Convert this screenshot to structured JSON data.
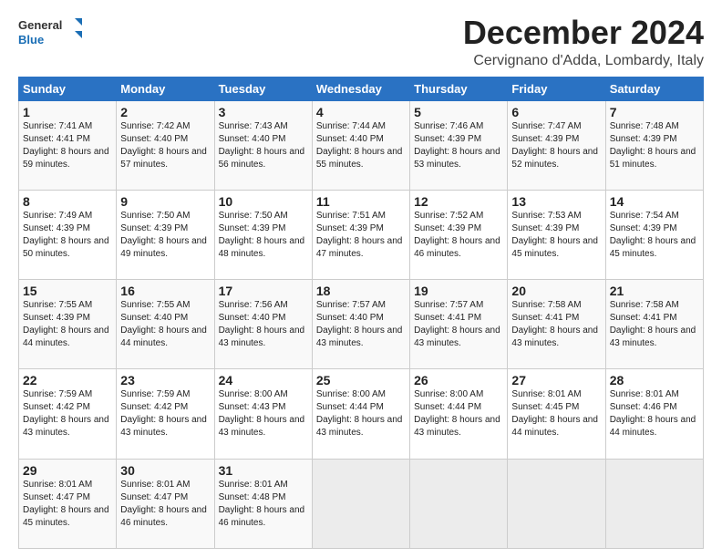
{
  "logo": {
    "line1": "General",
    "line2": "Blue"
  },
  "title": "December 2024",
  "location": "Cervignano d'Adda, Lombardy, Italy",
  "weekdays": [
    "Sunday",
    "Monday",
    "Tuesday",
    "Wednesday",
    "Thursday",
    "Friday",
    "Saturday"
  ],
  "weeks": [
    [
      {
        "day": 1,
        "sunrise": "7:41 AM",
        "sunset": "4:41 PM",
        "daylight": "8 hours and 59 minutes."
      },
      {
        "day": 2,
        "sunrise": "7:42 AM",
        "sunset": "4:40 PM",
        "daylight": "8 hours and 57 minutes."
      },
      {
        "day": 3,
        "sunrise": "7:43 AM",
        "sunset": "4:40 PM",
        "daylight": "8 hours and 56 minutes."
      },
      {
        "day": 4,
        "sunrise": "7:44 AM",
        "sunset": "4:40 PM",
        "daylight": "8 hours and 55 minutes."
      },
      {
        "day": 5,
        "sunrise": "7:46 AM",
        "sunset": "4:39 PM",
        "daylight": "8 hours and 53 minutes."
      },
      {
        "day": 6,
        "sunrise": "7:47 AM",
        "sunset": "4:39 PM",
        "daylight": "8 hours and 52 minutes."
      },
      {
        "day": 7,
        "sunrise": "7:48 AM",
        "sunset": "4:39 PM",
        "daylight": "8 hours and 51 minutes."
      }
    ],
    [
      {
        "day": 8,
        "sunrise": "7:49 AM",
        "sunset": "4:39 PM",
        "daylight": "8 hours and 50 minutes."
      },
      {
        "day": 9,
        "sunrise": "7:50 AM",
        "sunset": "4:39 PM",
        "daylight": "8 hours and 49 minutes."
      },
      {
        "day": 10,
        "sunrise": "7:50 AM",
        "sunset": "4:39 PM",
        "daylight": "8 hours and 48 minutes."
      },
      {
        "day": 11,
        "sunrise": "7:51 AM",
        "sunset": "4:39 PM",
        "daylight": "8 hours and 47 minutes."
      },
      {
        "day": 12,
        "sunrise": "7:52 AM",
        "sunset": "4:39 PM",
        "daylight": "8 hours and 46 minutes."
      },
      {
        "day": 13,
        "sunrise": "7:53 AM",
        "sunset": "4:39 PM",
        "daylight": "8 hours and 45 minutes."
      },
      {
        "day": 14,
        "sunrise": "7:54 AM",
        "sunset": "4:39 PM",
        "daylight": "8 hours and 45 minutes."
      }
    ],
    [
      {
        "day": 15,
        "sunrise": "7:55 AM",
        "sunset": "4:39 PM",
        "daylight": "8 hours and 44 minutes."
      },
      {
        "day": 16,
        "sunrise": "7:55 AM",
        "sunset": "4:40 PM",
        "daylight": "8 hours and 44 minutes."
      },
      {
        "day": 17,
        "sunrise": "7:56 AM",
        "sunset": "4:40 PM",
        "daylight": "8 hours and 43 minutes."
      },
      {
        "day": 18,
        "sunrise": "7:57 AM",
        "sunset": "4:40 PM",
        "daylight": "8 hours and 43 minutes."
      },
      {
        "day": 19,
        "sunrise": "7:57 AM",
        "sunset": "4:41 PM",
        "daylight": "8 hours and 43 minutes."
      },
      {
        "day": 20,
        "sunrise": "7:58 AM",
        "sunset": "4:41 PM",
        "daylight": "8 hours and 43 minutes."
      },
      {
        "day": 21,
        "sunrise": "7:58 AM",
        "sunset": "4:41 PM",
        "daylight": "8 hours and 43 minutes."
      }
    ],
    [
      {
        "day": 22,
        "sunrise": "7:59 AM",
        "sunset": "4:42 PM",
        "daylight": "8 hours and 43 minutes."
      },
      {
        "day": 23,
        "sunrise": "7:59 AM",
        "sunset": "4:42 PM",
        "daylight": "8 hours and 43 minutes."
      },
      {
        "day": 24,
        "sunrise": "8:00 AM",
        "sunset": "4:43 PM",
        "daylight": "8 hours and 43 minutes."
      },
      {
        "day": 25,
        "sunrise": "8:00 AM",
        "sunset": "4:44 PM",
        "daylight": "8 hours and 43 minutes."
      },
      {
        "day": 26,
        "sunrise": "8:00 AM",
        "sunset": "4:44 PM",
        "daylight": "8 hours and 43 minutes."
      },
      {
        "day": 27,
        "sunrise": "8:01 AM",
        "sunset": "4:45 PM",
        "daylight": "8 hours and 44 minutes."
      },
      {
        "day": 28,
        "sunrise": "8:01 AM",
        "sunset": "4:46 PM",
        "daylight": "8 hours and 44 minutes."
      }
    ],
    [
      {
        "day": 29,
        "sunrise": "8:01 AM",
        "sunset": "4:47 PM",
        "daylight": "8 hours and 45 minutes."
      },
      {
        "day": 30,
        "sunrise": "8:01 AM",
        "sunset": "4:47 PM",
        "daylight": "8 hours and 46 minutes."
      },
      {
        "day": 31,
        "sunrise": "8:01 AM",
        "sunset": "4:48 PM",
        "daylight": "8 hours and 46 minutes."
      },
      null,
      null,
      null,
      null
    ]
  ]
}
